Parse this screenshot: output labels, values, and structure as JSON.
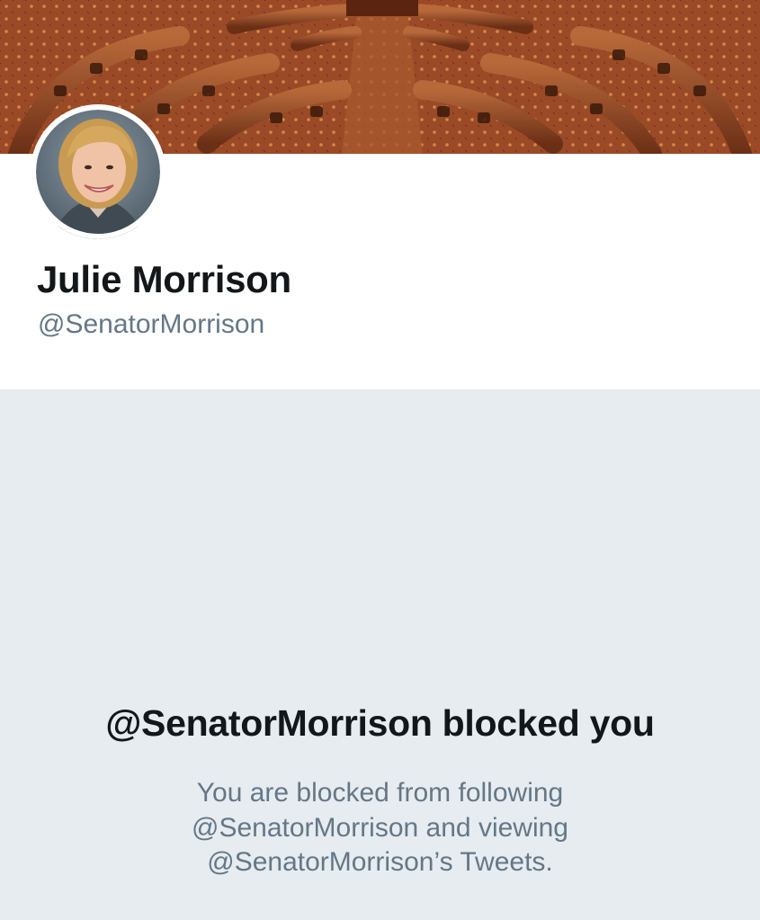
{
  "profile": {
    "display_name": "Julie Morrison",
    "handle": "@SenatorMorrison"
  },
  "blocked_notice": {
    "title": "@SenatorMorrison blocked you",
    "description": "You are blocked from following @SenatorMorrison and viewing @SenatorMorrison’s Tweets."
  },
  "colors": {
    "primary_text": "#14171a",
    "secondary_text": "#657786",
    "panel_background": "#e6ecf0",
    "banner_carpet": "#a0522d",
    "banner_wood": "#7a3b1c"
  },
  "icons": {
    "banner": "legislative-chamber-photo",
    "avatar": "profile-photo"
  }
}
